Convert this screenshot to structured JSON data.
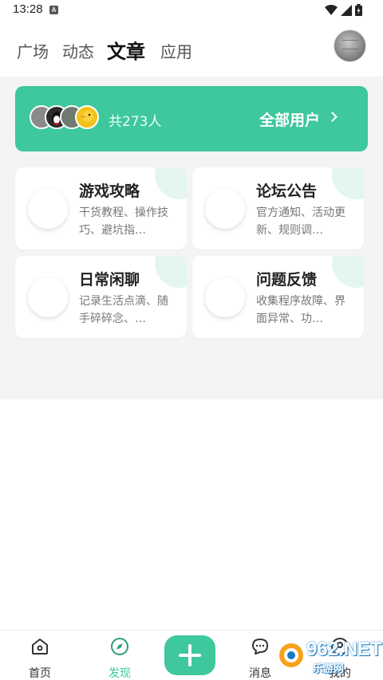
{
  "status_bar": {
    "time": "13:28",
    "a_icon": "A"
  },
  "top_nav": {
    "tabs": [
      {
        "label": "广场",
        "active": false
      },
      {
        "label": "动态",
        "active": false
      },
      {
        "label": "文章",
        "active": true
      },
      {
        "label": "应用",
        "active": false
      }
    ]
  },
  "users_banner": {
    "count_text": "共273人",
    "all_users_label": "全部用户",
    "avatar_colors": [
      "#8a8a8a",
      "#2b2b2b",
      "#6f7a70",
      "#f2c21b"
    ]
  },
  "categories": [
    {
      "title": "游戏攻略",
      "desc": "干货教程、操作技巧、避坑指…"
    },
    {
      "title": "论坛公告",
      "desc": "官方通知、活动更新、规则调…"
    },
    {
      "title": "日常闲聊",
      "desc": "记录生活点滴、随手碎碎念、…"
    },
    {
      "title": "问题反馈",
      "desc": "收集程序故障、界面异常、功…"
    }
  ],
  "bottom_nav": {
    "items": [
      {
        "label": "首页",
        "icon": "home-icon",
        "active": false
      },
      {
        "label": "发现",
        "icon": "compass-icon",
        "active": true
      },
      {
        "label": "消息",
        "icon": "chat-icon",
        "active": false
      },
      {
        "label": "我的",
        "icon": "user-icon",
        "active": false
      }
    ],
    "fab_icon": "plus-icon"
  },
  "watermark": {
    "number": "962.NET",
    "text": "乐游网"
  },
  "colors": {
    "accent": "#3fc79d",
    "background": "#f4f4f4",
    "card_deco": "#e4f6ef"
  }
}
